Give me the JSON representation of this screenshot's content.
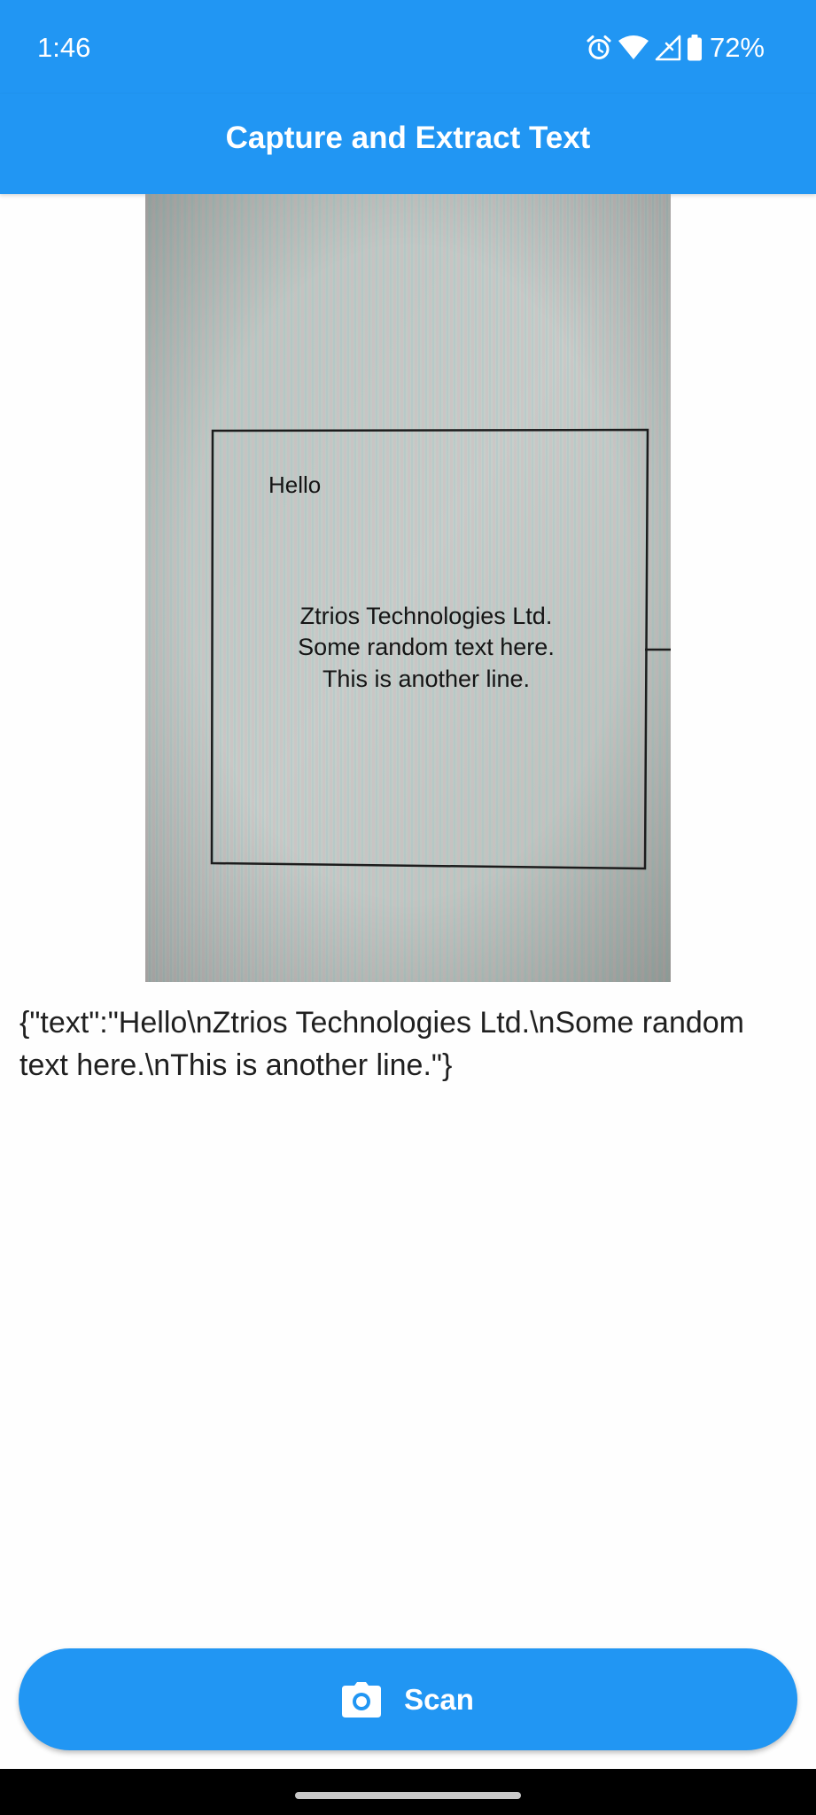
{
  "status_bar": {
    "time": "1:46",
    "battery_percent": "72%",
    "icons": [
      "alarm-icon",
      "wifi-icon",
      "signal-icon",
      "battery-icon"
    ]
  },
  "app_bar": {
    "title": "Capture and Extract Text"
  },
  "captured_image": {
    "lines": {
      "hello": "Hello",
      "line1": "Ztrios Technologies Ltd.",
      "line2": "Some random text here.",
      "line3": "This is another line."
    }
  },
  "result": {
    "text": "{\"text\":\"Hello\\nZtrios Technologies Ltd.\\nSome random text here.\\nThis is another line.\"}"
  },
  "scan_button": {
    "label": "Scan",
    "icon": "camera-icon"
  },
  "colors": {
    "primary": "#2196f3",
    "on_primary": "#ffffff",
    "body_text": "#202020",
    "background": "#fefefe"
  }
}
